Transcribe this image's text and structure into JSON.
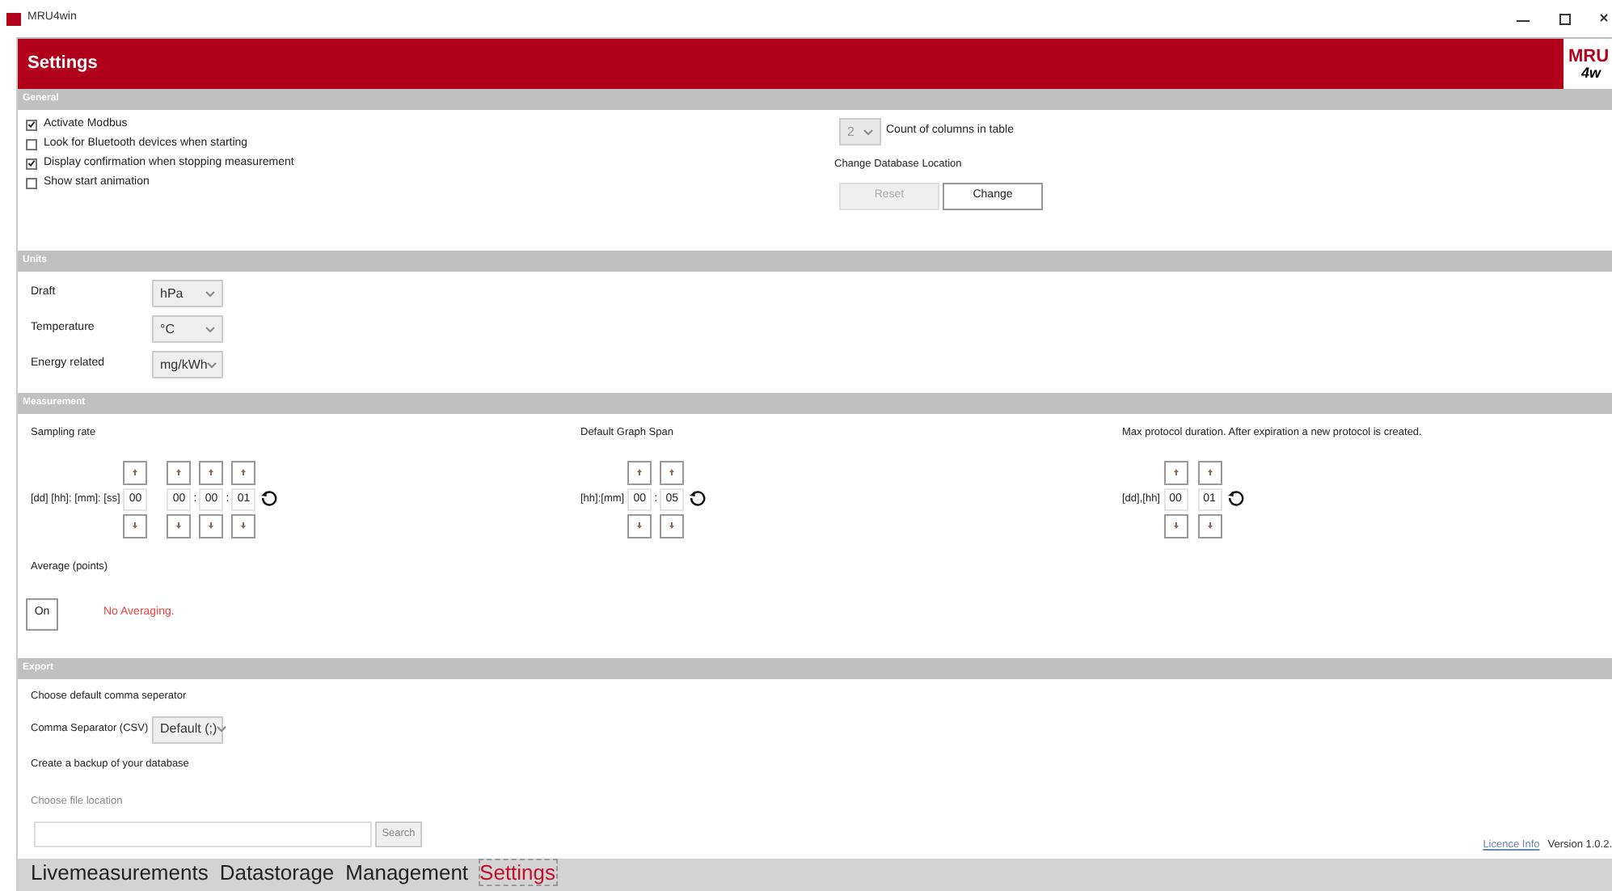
{
  "window": {
    "title": "MRU4win"
  },
  "header": {
    "title": "Settings",
    "logo": [
      "MRU",
      "4w"
    ]
  },
  "general": {
    "title": "General",
    "checkboxes": [
      {
        "label": "Activate Modbus",
        "checked": true
      },
      {
        "label": "Look for Bluetooth devices when starting",
        "checked": false
      },
      {
        "label": "Display confirmation when stopping measurement",
        "checked": true
      },
      {
        "label": "Show start animation",
        "checked": false
      }
    ],
    "columns_select": {
      "value": "2",
      "label": "Count of columns in table"
    },
    "database": {
      "label": "Change Database Location",
      "buttons": [
        {
          "label": "Reset",
          "disabled": true
        },
        {
          "label": "Change",
          "disabled": false
        }
      ]
    }
  },
  "units": {
    "title": "Units",
    "rows": [
      {
        "label": "Draft",
        "value": "hPa"
      },
      {
        "label": "Temperature",
        "value": "°C"
      },
      {
        "label": "Energy related",
        "value": "mg/kWh"
      }
    ]
  },
  "measurement": {
    "title": "Measurement",
    "spans": [
      {
        "title": "Sampling rate",
        "format": "[dd] [hh]: [mm]: [ss]",
        "fields": [
          {
            "value": "00"
          },
          {
            "value": "00",
            "sep": ":"
          },
          {
            "value": "00",
            "sep": ":"
          },
          {
            "value": "01"
          }
        ]
      },
      {
        "title": "Default Graph Span",
        "format": "[hh]:[mm]",
        "fields": [
          {
            "value": "00",
            "sep": ":"
          },
          {
            "value": "05"
          }
        ]
      },
      {
        "title": "Max protocol duration. After expiration a new protocol is created.",
        "format": "[dd],[hh]",
        "fields": [
          {
            "value": "00"
          },
          {
            "value": "01"
          }
        ]
      }
    ],
    "average": {
      "label": "Average (points)",
      "button": "On",
      "status": "No Averaging."
    }
  },
  "export": {
    "title": "Export",
    "separator_heading": "Choose default comma seperator",
    "separator_label": "Comma Separator (CSV)",
    "separator_value": "Default (;)",
    "backup_heading": "Create a backup of your database",
    "file_placeholder": "Choose file location",
    "search_button": "Search"
  },
  "footer": {
    "link": "Licence Info",
    "version": "Version 1.0.2."
  },
  "tabs": [
    {
      "label": "Livemeasurements",
      "selected": false
    },
    {
      "label": "Datastorage",
      "selected": false
    },
    {
      "label": "Management",
      "selected": false
    },
    {
      "label": "Settings",
      "selected": true
    }
  ]
}
